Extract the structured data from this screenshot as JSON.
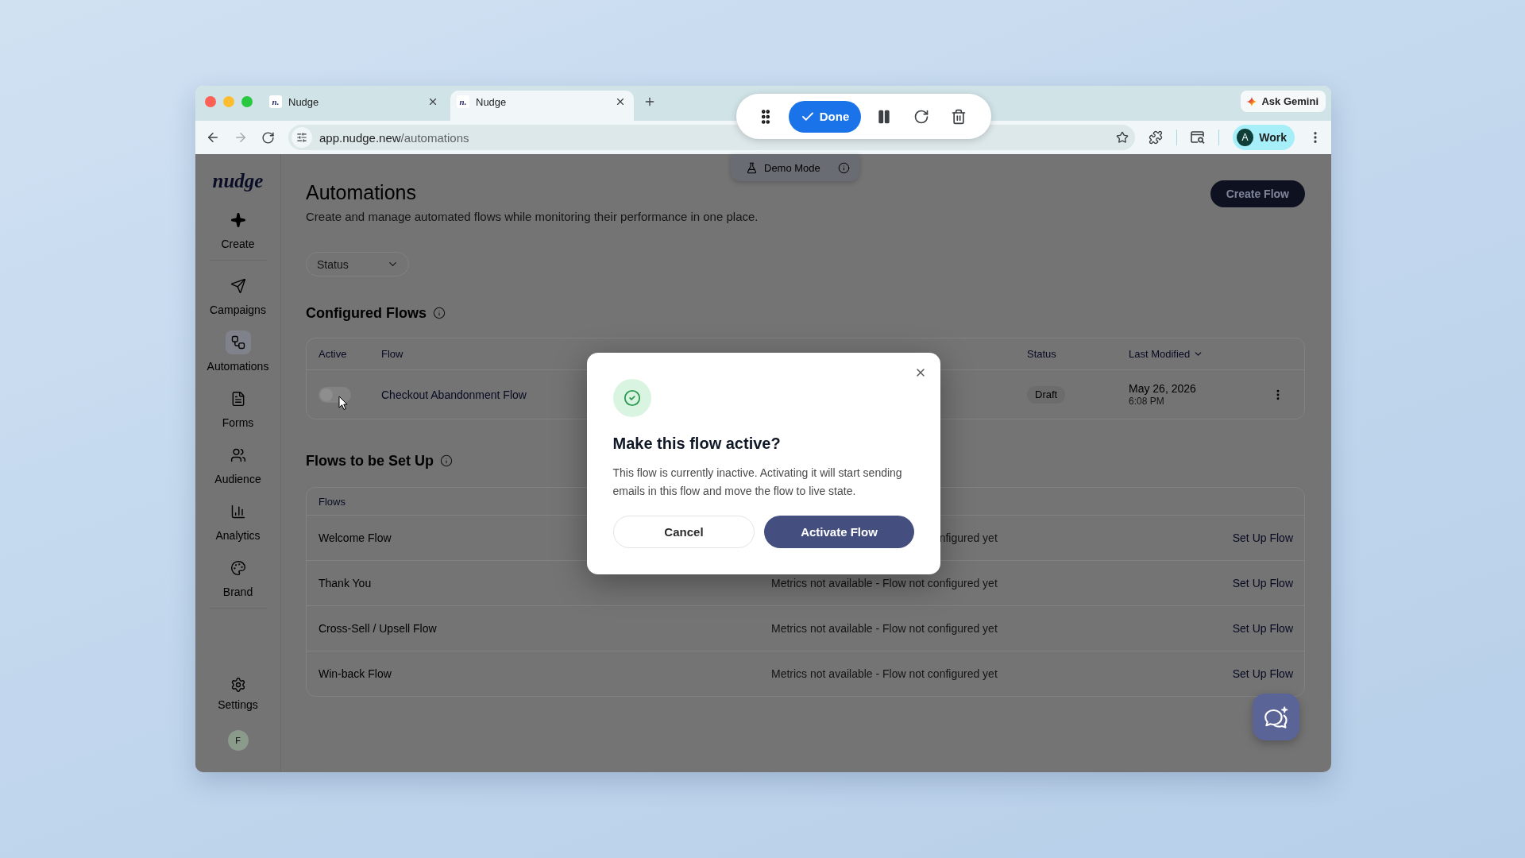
{
  "browser": {
    "tabs": [
      {
        "favicon_text": "n.",
        "title": "Nudge",
        "selected": false
      },
      {
        "favicon_text": "n.",
        "title": "Nudge",
        "selected": true
      }
    ],
    "ask_gemini": "Ask Gemini",
    "address_bar": {
      "host": "app.nudge.new",
      "path": "/automations"
    },
    "profile": {
      "initial": "A",
      "label": "Work"
    },
    "recorder": {
      "done": "Done"
    }
  },
  "sidebar": {
    "logo": "nudge",
    "sections": [
      {
        "items": [
          {
            "label": "Create",
            "selected": false
          }
        ]
      },
      {
        "items": [
          {
            "label": "Campaigns",
            "selected": false
          },
          {
            "label": "Automations",
            "selected": true
          },
          {
            "label": "Forms",
            "selected": false
          },
          {
            "label": "Audience",
            "selected": false
          },
          {
            "label": "Analytics",
            "selected": false
          },
          {
            "label": "Brand",
            "selected": false
          }
        ]
      }
    ],
    "settings": {
      "label": "Settings"
    },
    "avatar": "F"
  },
  "demo_mode": {
    "label": "Demo Mode"
  },
  "header": {
    "title": "Automations",
    "subtitle": "Create and manage automated flows while monitoring their performance in one place.",
    "create_button": "Create Flow"
  },
  "filter": {
    "label": "Status"
  },
  "configured": {
    "heading": "Configured Flows",
    "columns": [
      {
        "label": "Active",
        "sorted": false
      },
      {
        "label": "Flow",
        "sorted": false
      },
      {
        "label": "Status",
        "sorted": false
      },
      {
        "label": "Last Modified",
        "sorted": true
      }
    ],
    "rows": [
      {
        "active": false,
        "name": "Checkout Abandonment Flow",
        "status": "Draft",
        "date": "May 26, 2026",
        "time": "6:08 PM"
      }
    ]
  },
  "setup": {
    "heading": "Flows to be Set Up",
    "column": "Flows",
    "rows": [
      {
        "name": "Welcome Flow",
        "metrics": "nfigured yet",
        "action": "Set Up Flow"
      },
      {
        "name": "Thank You",
        "metrics": "Metrics not available - Flow not configured yet",
        "action": "Set Up Flow"
      },
      {
        "name": "Cross-Sell / Upsell Flow",
        "metrics": "Metrics not available - Flow not configured yet",
        "action": "Set Up Flow"
      },
      {
        "name": "Win-back Flow",
        "metrics": "Metrics not available - Flow not configured yet",
        "action": "Set Up Flow"
      }
    ]
  },
  "dialog": {
    "title": "Make this flow active?",
    "body": "This flow is currently inactive. Activating it will start sending emails in this flow and move the flow to live state.",
    "cancel": "Cancel",
    "confirm": "Activate Flow"
  }
}
